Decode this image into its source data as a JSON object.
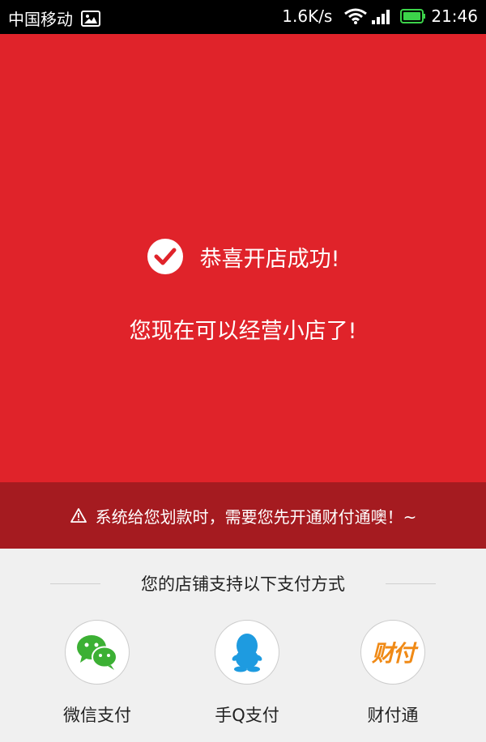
{
  "status_bar": {
    "carrier": "中国移动",
    "speed": "1.6K/s",
    "time": "21:46"
  },
  "hero": {
    "title": "恭喜开店成功!",
    "subtitle": "您现在可以经营小店了!"
  },
  "notice": {
    "text": "系统给您划款时，需要您先开通财付通噢！~"
  },
  "payment": {
    "title": "您的店铺支持以下支付方式",
    "methods": [
      {
        "label": "微信支付",
        "icon": "wechat-icon"
      },
      {
        "label": "手Q支付",
        "icon": "qq-icon"
      },
      {
        "label": "财付通",
        "icon": "tenpay-icon",
        "logo_text": "财付"
      }
    ]
  },
  "colors": {
    "hero_bg": "#e0232a",
    "notice_bg": "#a51b20",
    "wechat_green": "#3cb034",
    "qq_blue": "#1e9be0",
    "tenpay_orange": "#f08a16"
  }
}
